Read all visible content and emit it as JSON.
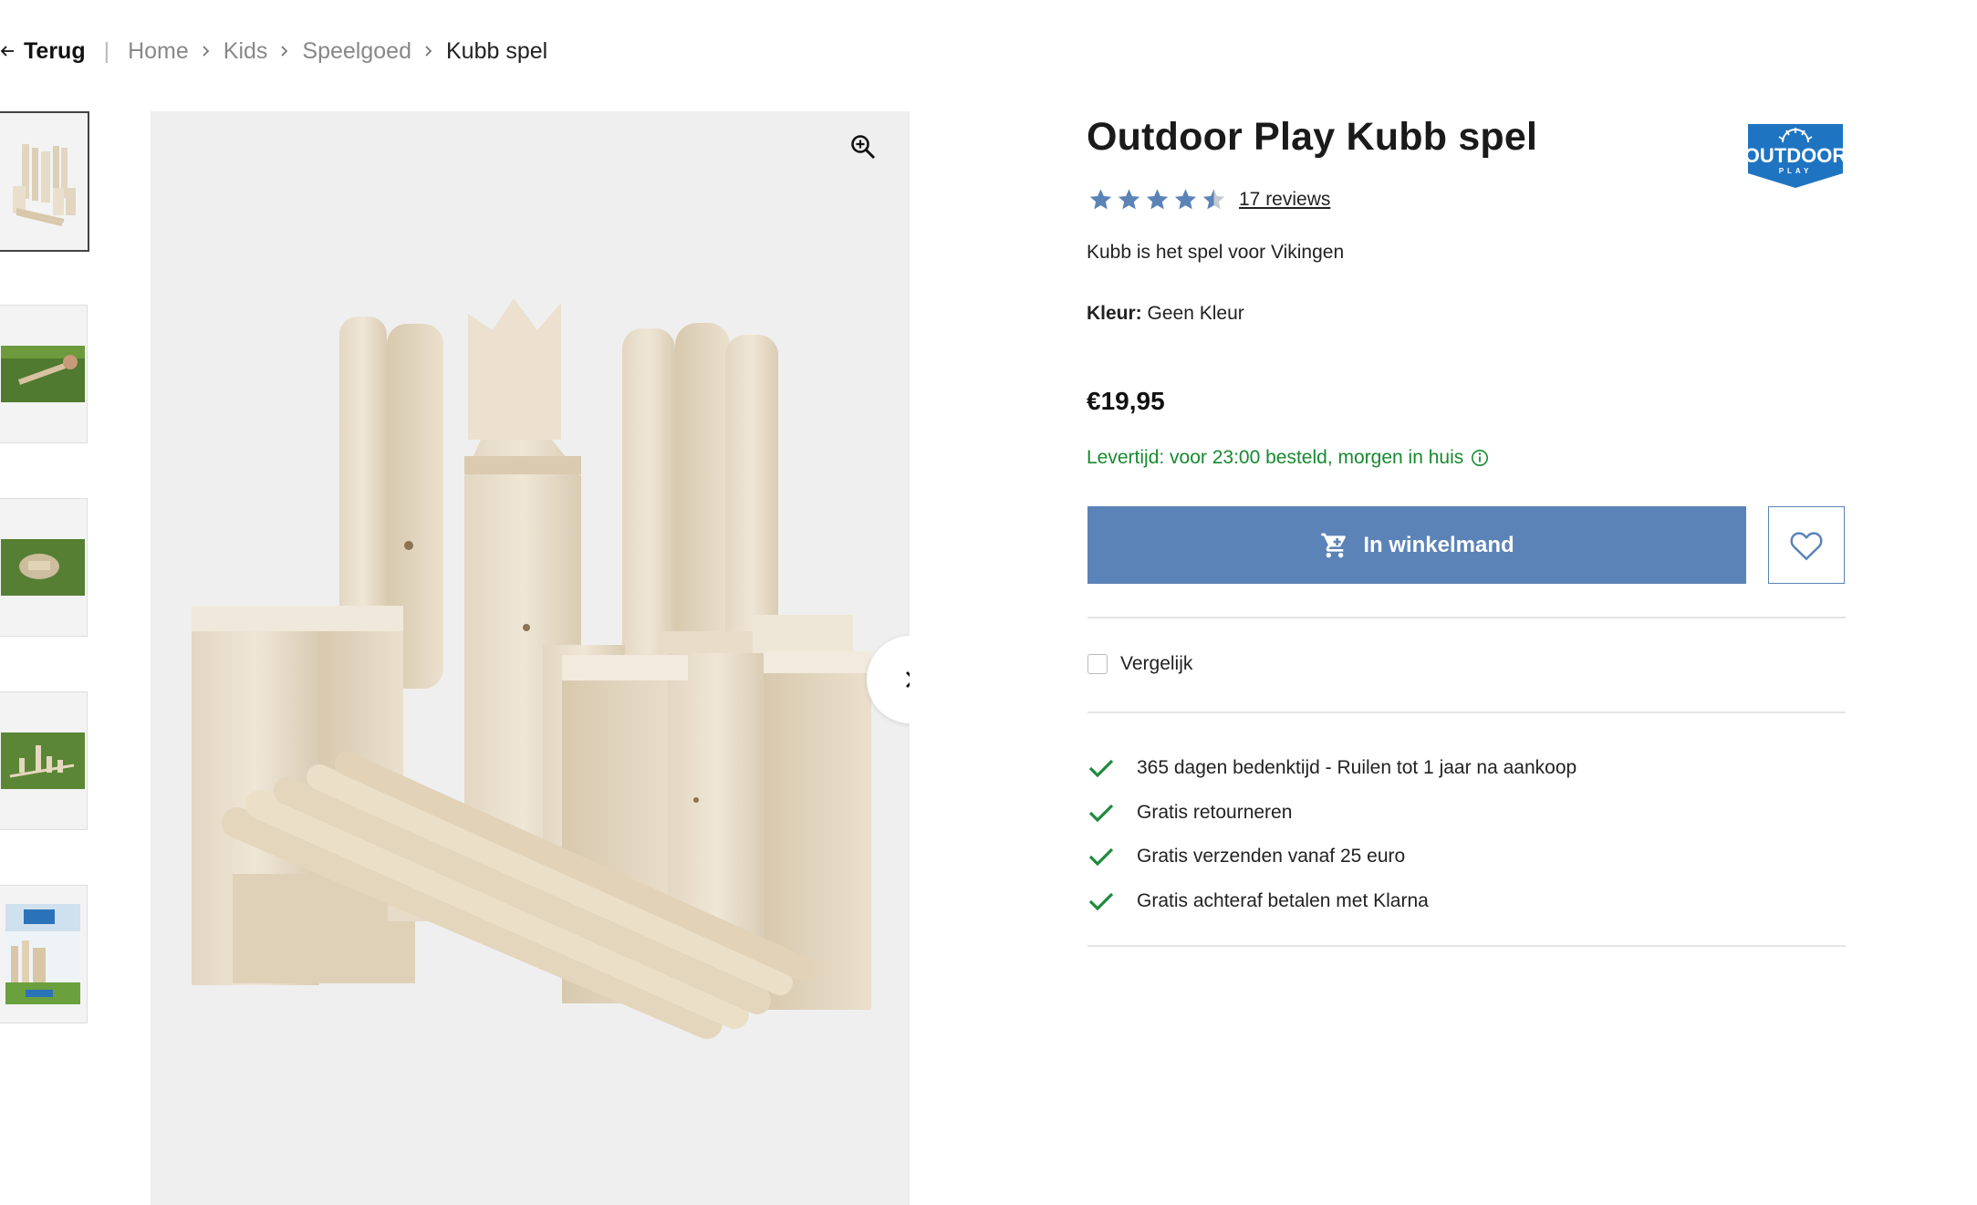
{
  "breadcrumb": {
    "back_label": "Terug",
    "items": [
      "Home",
      "Kids",
      "Speelgoed"
    ],
    "current": "Kubb spel"
  },
  "product": {
    "title": "Outdoor Play Kubb spel",
    "brand_logo_text": "OUTDOOR",
    "brand_logo_subtext": "PLAY",
    "rating": 4.5,
    "rating_max": 5,
    "reviews_label": "17 reviews",
    "description": "Kubb is het spel voor Vikingen",
    "color_label": "Kleur:",
    "color_value": "Geen Kleur",
    "price": "€19,95",
    "delivery": "Levertijd: voor 23:00 besteld, morgen in huis",
    "add_to_cart_label": "In winkelmand",
    "compare_label": "Vergelijk",
    "usps": [
      "365 dagen bedenktijd - Ruilen tot 1 jaar na aankoop",
      "Gratis retourneren",
      "Gratis verzenden vanaf 25 euro",
      "Gratis achteraf betalen met Klarna"
    ]
  },
  "gallery": {
    "thumbnail_count": 5,
    "active_index": 0
  },
  "colors": {
    "accent": "#5b83b7",
    "delivery_green": "#178a2f",
    "check_green": "#1e8a3c",
    "star": "#5b83b7"
  },
  "icons": {
    "back": "arrow-left-icon",
    "breadcrumb_separator": "chevron-right-icon",
    "zoom": "zoom-in-icon",
    "next": "chevron-right-icon",
    "cart": "shopping-cart-icon",
    "wishlist": "heart-icon",
    "info": "info-icon",
    "usp": "check-icon"
  }
}
